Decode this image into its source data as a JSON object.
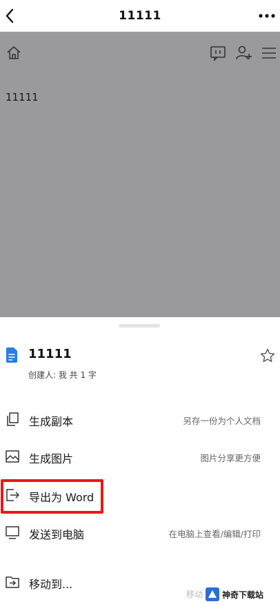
{
  "header": {
    "title": "11111"
  },
  "document": {
    "text": "11111"
  },
  "sheet": {
    "file_name": "11111",
    "file_info": "创建人: 我 共 1 字"
  },
  "menu": [
    {
      "label": "生成副本",
      "hint": "另存一份为个人文档",
      "icon": "copy-icon"
    },
    {
      "label": "生成图片",
      "hint": "图片分享更方便",
      "icon": "image-icon"
    },
    {
      "label": "导出为 Word",
      "hint": "",
      "icon": "export-icon"
    },
    {
      "label": "发送到电脑",
      "hint": "在电脑上查看/编辑/打印",
      "icon": "monitor-icon"
    },
    {
      "label": "移动到...",
      "hint": "移动",
      "icon": "move-icon"
    }
  ],
  "watermark": {
    "text": "神奇下载站"
  },
  "colors": {
    "highlight": "#e61919",
    "file_icon": "#2a7de1",
    "overlay": "#9a9a9c"
  }
}
